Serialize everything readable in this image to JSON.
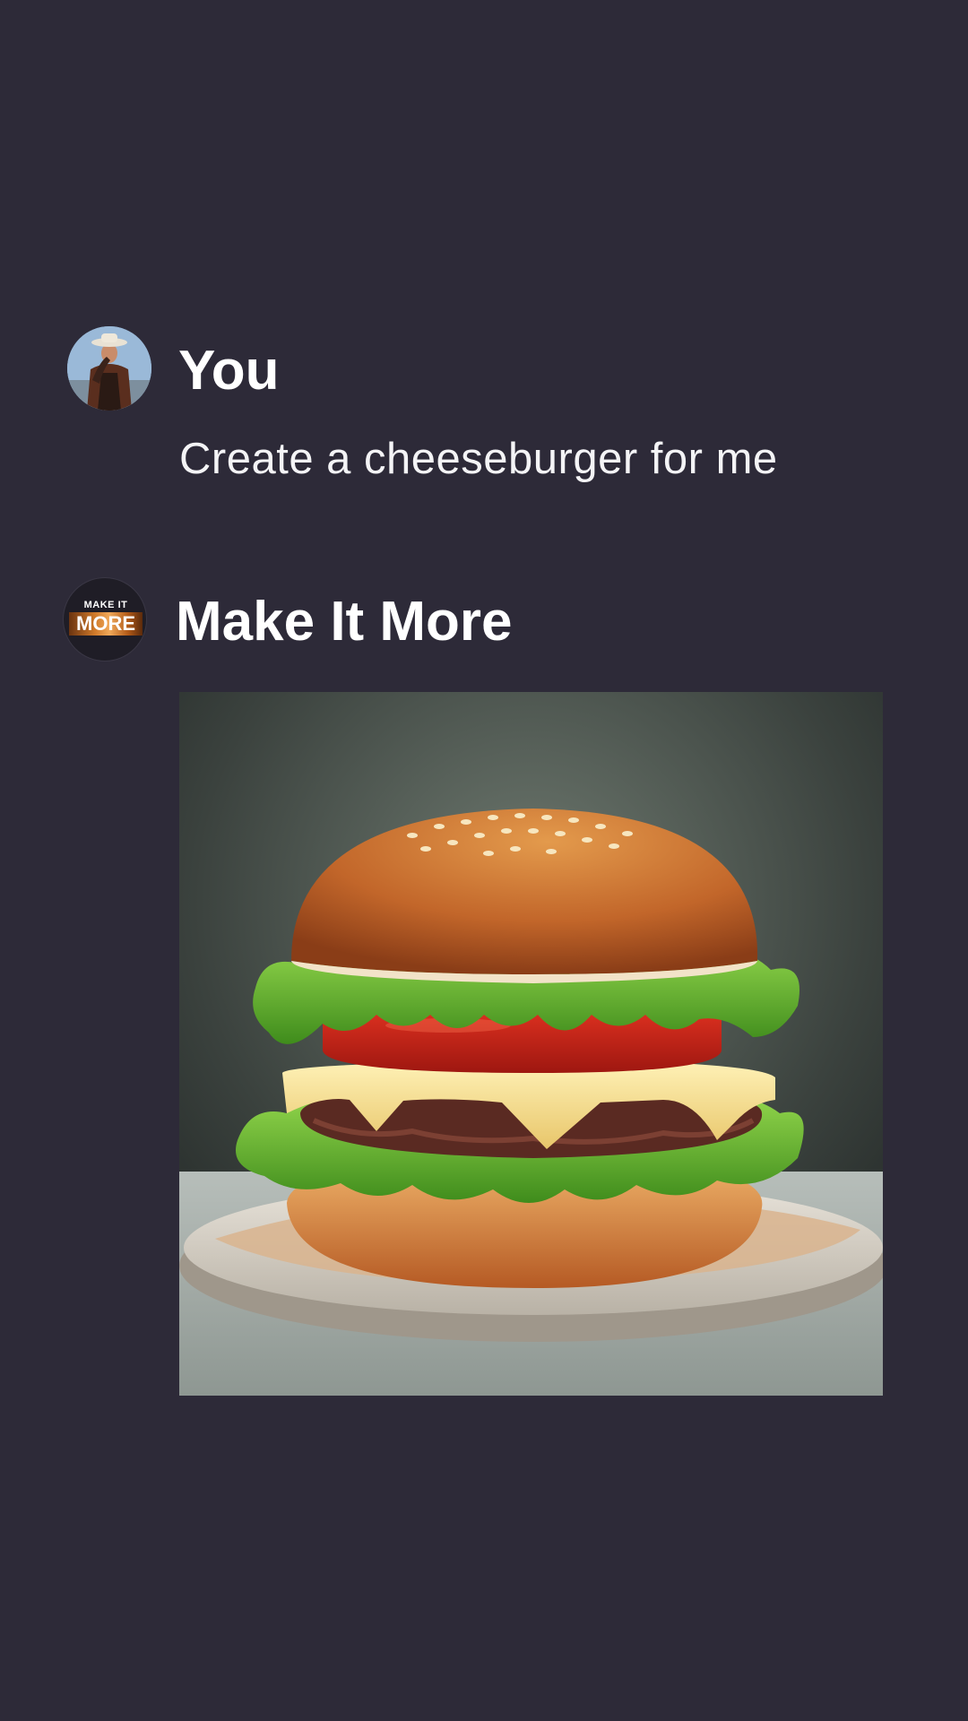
{
  "conversation": {
    "user": {
      "name": "You",
      "message": "Create a cheeseburger for me",
      "avatar_icon": "user-avatar-cowboy"
    },
    "assistant": {
      "name": "Make It More",
      "logo": {
        "line1": "MAKE IT",
        "line2": "MORE"
      },
      "image_subject": "cheeseburger-image"
    }
  },
  "colors": {
    "background": "#2d2a38",
    "text": "#ffffff",
    "logo_accent": "#d07a2a"
  }
}
